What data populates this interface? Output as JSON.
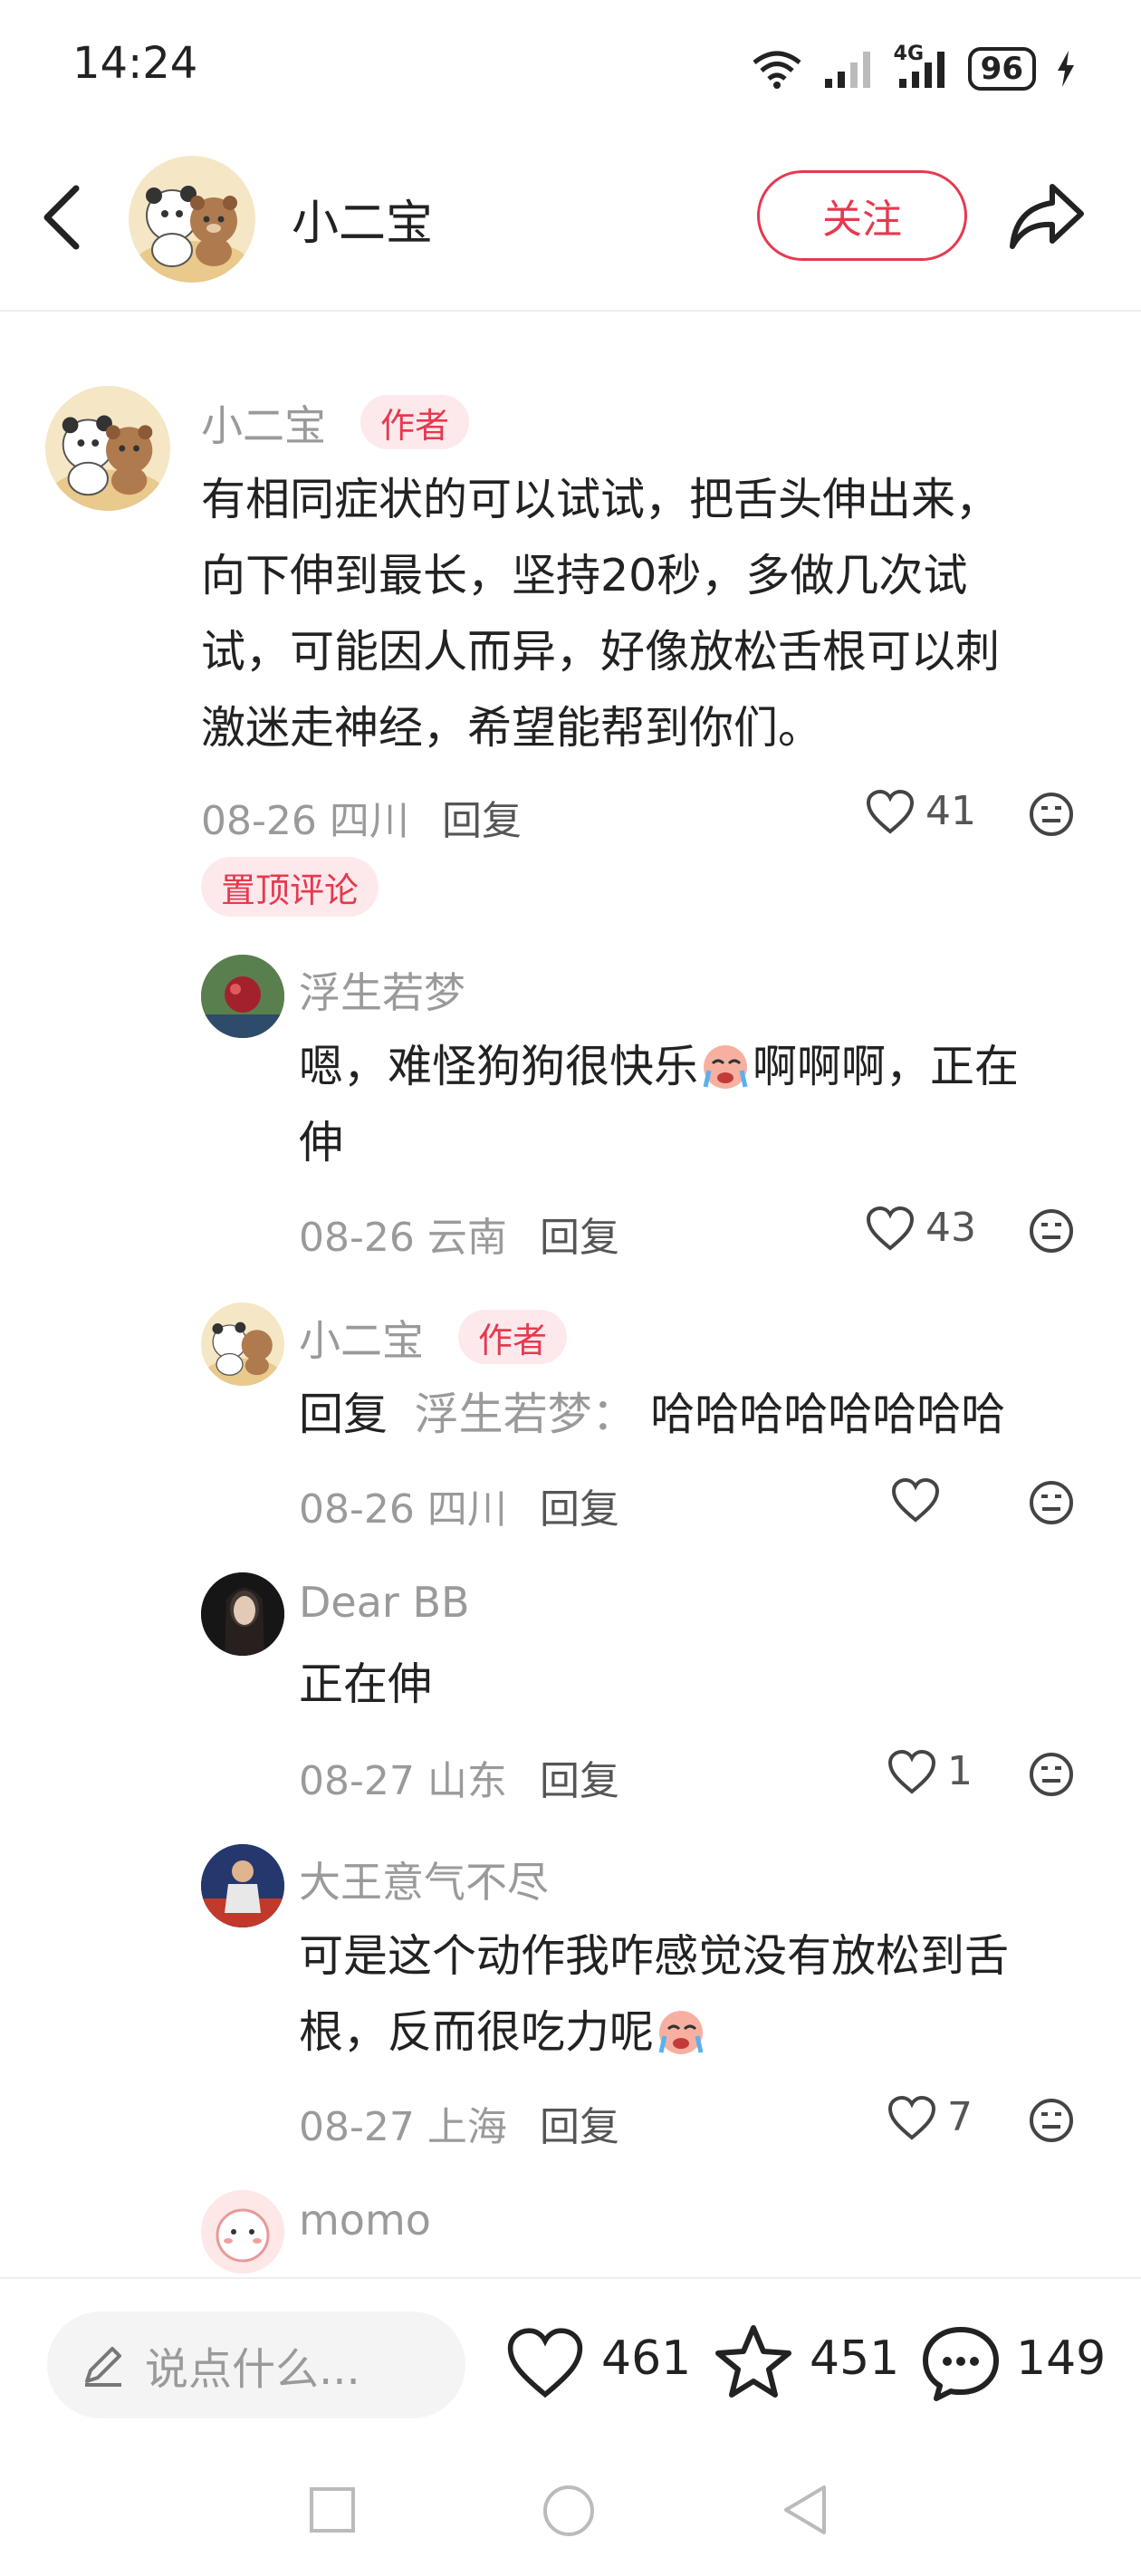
{
  "status": {
    "time": "14:24",
    "battery": "96",
    "network": "4G"
  },
  "header": {
    "title": "小二宝",
    "follow_label": "关注"
  },
  "comments": [
    {
      "user": "小二宝",
      "badge": "作者",
      "text_lines": [
        "有相同症状的可以试试，把舌头伸出来，",
        "向下伸到最长，坚持20秒，多做几次试",
        "试，可能因人而异，好像放松舌根可以刺",
        "激迷走神经，希望能帮到你们。"
      ],
      "date_location": "08-26 四川",
      "reply_label": "回复",
      "likes": "41",
      "pin_label": "置顶评论"
    }
  ],
  "replies": [
    {
      "user": "浮生若梦",
      "text_line1": "嗯，难怪狗狗很快乐",
      "text_line1_after": "啊啊啊，正在",
      "text_line2": "伸",
      "date_location": "08-26 云南",
      "reply_label": "回复",
      "likes": "43"
    },
    {
      "user": "小二宝",
      "badge": "作者",
      "reply_prefix": "回复",
      "reply_to": "浮生若梦：",
      "text": "哈哈哈哈哈哈哈哈",
      "date_location": "08-26 四川",
      "reply_label": "回复",
      "likes": ""
    },
    {
      "user": "Dear BB",
      "text": "正在伸",
      "date_location": "08-27 山东",
      "reply_label": "回复",
      "likes": "1"
    },
    {
      "user": "大王意气不尽",
      "text_line1": "可是这个动作我咋感觉没有放松到舌",
      "text_line2": "根，反而很吃力呢",
      "date_location": "08-27 上海",
      "reply_label": "回复",
      "likes": "7"
    },
    {
      "user": "momo"
    }
  ],
  "bottom": {
    "input_placeholder": "说点什么...",
    "likes": "461",
    "stars": "451",
    "comments": "149"
  },
  "colors": {
    "accent": "#e6394f",
    "muted": "#9a9a9a"
  }
}
